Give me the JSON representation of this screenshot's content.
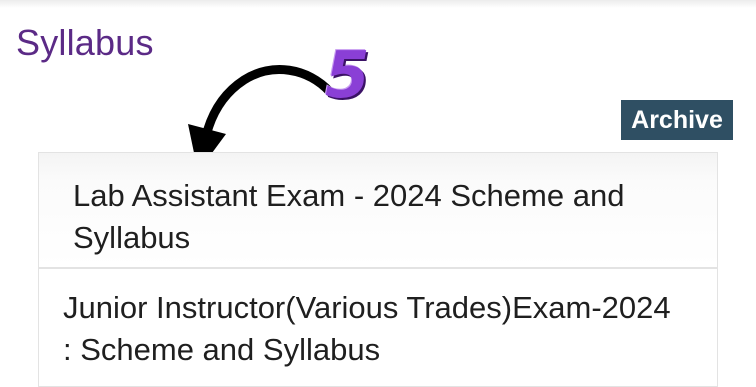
{
  "header": {
    "title": "Syllabus"
  },
  "annotation": {
    "number": "5",
    "icon": "curved-arrow-icon"
  },
  "archive": {
    "label": "Archive",
    "color": "#2f4f63"
  },
  "list": {
    "items": [
      {
        "label": "Lab Assistant Exam - 2024 Scheme and Syllabus"
      },
      {
        "label": "Junior Instructor(Various Trades)Exam-2024 : Scheme and Syllabus"
      }
    ]
  },
  "colors": {
    "title": "#5b2a86",
    "annotation": "#8a3fd6"
  }
}
